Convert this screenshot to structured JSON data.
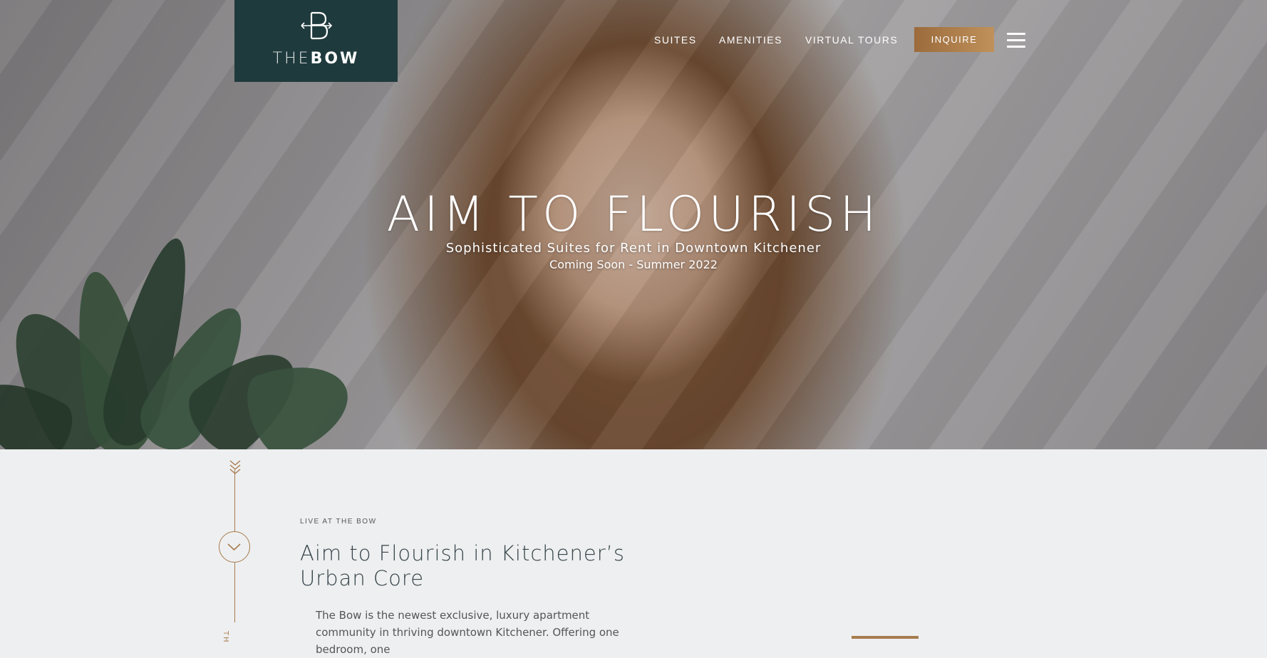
{
  "logo": {
    "text_light": "THE",
    "text_bold": "BOW"
  },
  "nav": {
    "items": [
      {
        "label": "SUITES"
      },
      {
        "label": "AMENITIES"
      },
      {
        "label": "VIRTUAL TOURS"
      }
    ],
    "cta_label": "INQUIRE"
  },
  "hero": {
    "title": "AIM TO FLOURISH",
    "subtitle": "Sophisticated Suites for Rent in Downtown Kitchener",
    "tagline": "Coming Soon - Summer 2022"
  },
  "intro": {
    "eyebrow": "LIVE AT THE BOW",
    "heading": "Aim to Flourish in Kitchener’s Urban Core",
    "body": "The Bow is the newest exclusive, luxury apartment community in thriving downtown Kitchener. Offering one bedroom, one",
    "side_label": "TH"
  },
  "colors": {
    "accent": "#a77c4e",
    "logo_bg": "#1f3a3c",
    "section_bg": "#eeeff0"
  },
  "icons": [
    "bow-logo-icon",
    "hamburger-menu-icon",
    "arrow-fletching-icon",
    "chevron-down-icon"
  ]
}
